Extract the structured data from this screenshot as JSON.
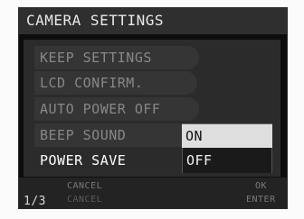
{
  "header": {
    "title": "CAMERA SETTINGS"
  },
  "menu": {
    "items": [
      {
        "label": "KEEP SETTINGS"
      },
      {
        "label": "LCD CONFIRM."
      },
      {
        "label": "AUTO POWER OFF"
      },
      {
        "label": "BEEP SOUND"
      },
      {
        "label": "POWER SAVE"
      }
    ]
  },
  "popup": {
    "options": [
      {
        "label": "ON",
        "selected": true
      },
      {
        "label": "OFF",
        "selected": false
      }
    ]
  },
  "footer": {
    "page": "1/3",
    "cancel_top": "CANCEL",
    "cancel_bottom": "CANCEL",
    "ok": "OK",
    "enter": "ENTER"
  }
}
